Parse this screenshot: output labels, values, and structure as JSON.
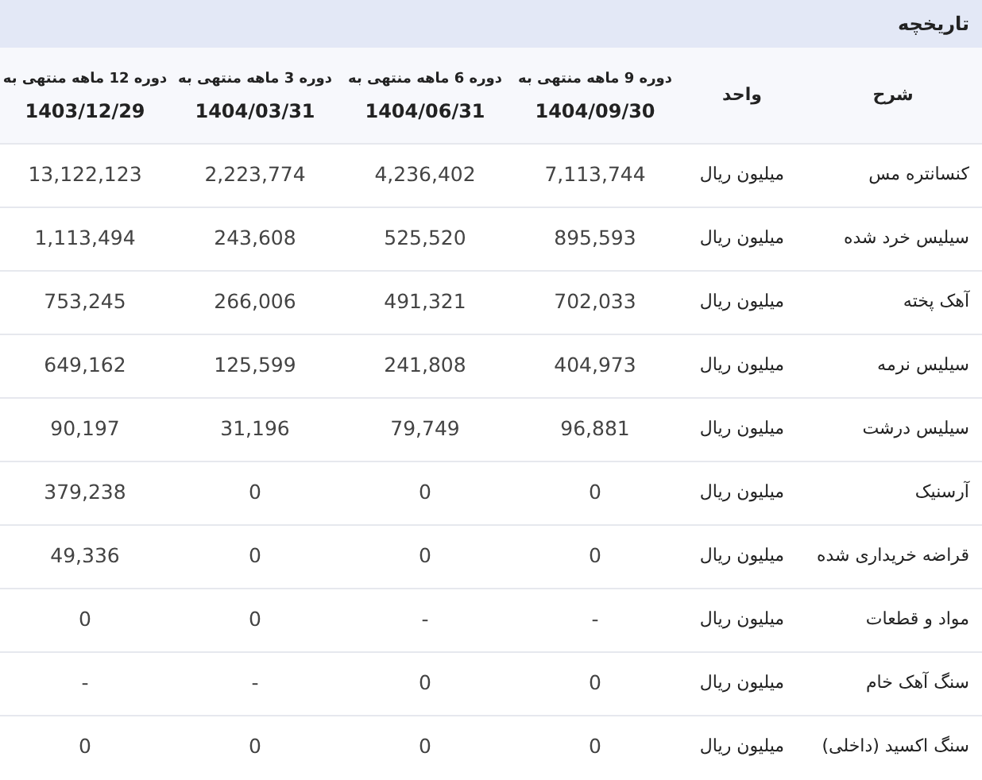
{
  "panel": {
    "title": "تاریخچه"
  },
  "table": {
    "columns": [
      {
        "label": "شرح"
      },
      {
        "label": "واحد"
      },
      {
        "label": "دوره 9 ماهه منتهی به",
        "date": "1404/09/30"
      },
      {
        "label": "دوره 6 ماهه منتهی به",
        "date": "1404/06/31"
      },
      {
        "label": "دوره 3 ماهه منتهی به",
        "date": "1404/03/31"
      },
      {
        "label": "دوره 12 ماهه منتهی به",
        "date": "1403/12/29"
      }
    ],
    "rows": [
      {
        "description": "کنسانتره مس",
        "unit": "میلیون ریال",
        "values": [
          "7,113,744",
          "4,236,402",
          "2,223,774",
          "13,122,123"
        ]
      },
      {
        "description": "سیلیس خرد شده",
        "unit": "میلیون ریال",
        "values": [
          "895,593",
          "525,520",
          "243,608",
          "1,113,494"
        ]
      },
      {
        "description": "آهک پخته",
        "unit": "میلیون ریال",
        "values": [
          "702,033",
          "491,321",
          "266,006",
          "753,245"
        ]
      },
      {
        "description": "سیلیس نرمه",
        "unit": "میلیون ریال",
        "values": [
          "404,973",
          "241,808",
          "125,599",
          "649,162"
        ]
      },
      {
        "description": "سیلیس درشت",
        "unit": "میلیون ریال",
        "values": [
          "96,881",
          "79,749",
          "31,196",
          "90,197"
        ]
      },
      {
        "description": "آرسنیک",
        "unit": "میلیون ریال",
        "values": [
          "0",
          "0",
          "0",
          "379,238"
        ]
      },
      {
        "description": "قراضه خریداری شده",
        "unit": "میلیون ریال",
        "values": [
          "0",
          "0",
          "0",
          "49,336"
        ]
      },
      {
        "description": "مواد و قطعات",
        "unit": "میلیون ریال",
        "values": [
          "-",
          "-",
          "0",
          "0"
        ]
      },
      {
        "description": "سنگ آهک خام",
        "unit": "میلیون ریال",
        "values": [
          "0",
          "0",
          "-",
          "-"
        ]
      },
      {
        "description": "سنگ اکسید (داخلی)",
        "unit": "میلیون ریال",
        "values": [
          "0",
          "0",
          "0",
          "0"
        ]
      }
    ]
  }
}
